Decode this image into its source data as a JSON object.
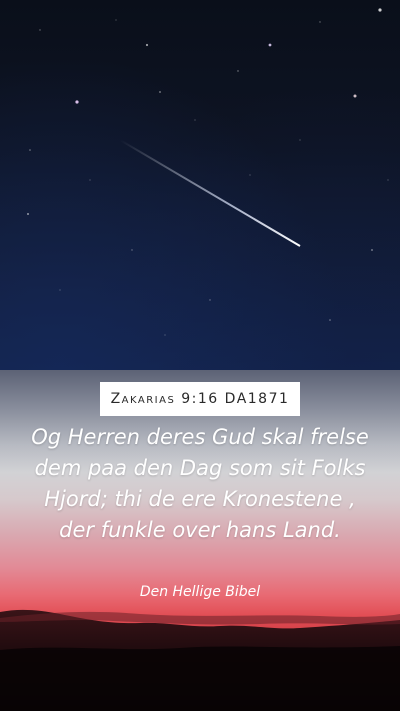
{
  "reference": "Zakarias 9:16 DA1871",
  "verse": "Og Herren deres Gud skal frelse dem paa den Dag som sit Folks Hjord; thi de ere Kronestene , der funkle over hans Land.",
  "source": "Den Hellige Bibel",
  "colors": {
    "sky_top": "#0a0f1a",
    "sky_bottom": "#15244a",
    "sunset_red": "#e24e55",
    "card_text": "#ffffff",
    "ref_box": "#ffffff"
  }
}
